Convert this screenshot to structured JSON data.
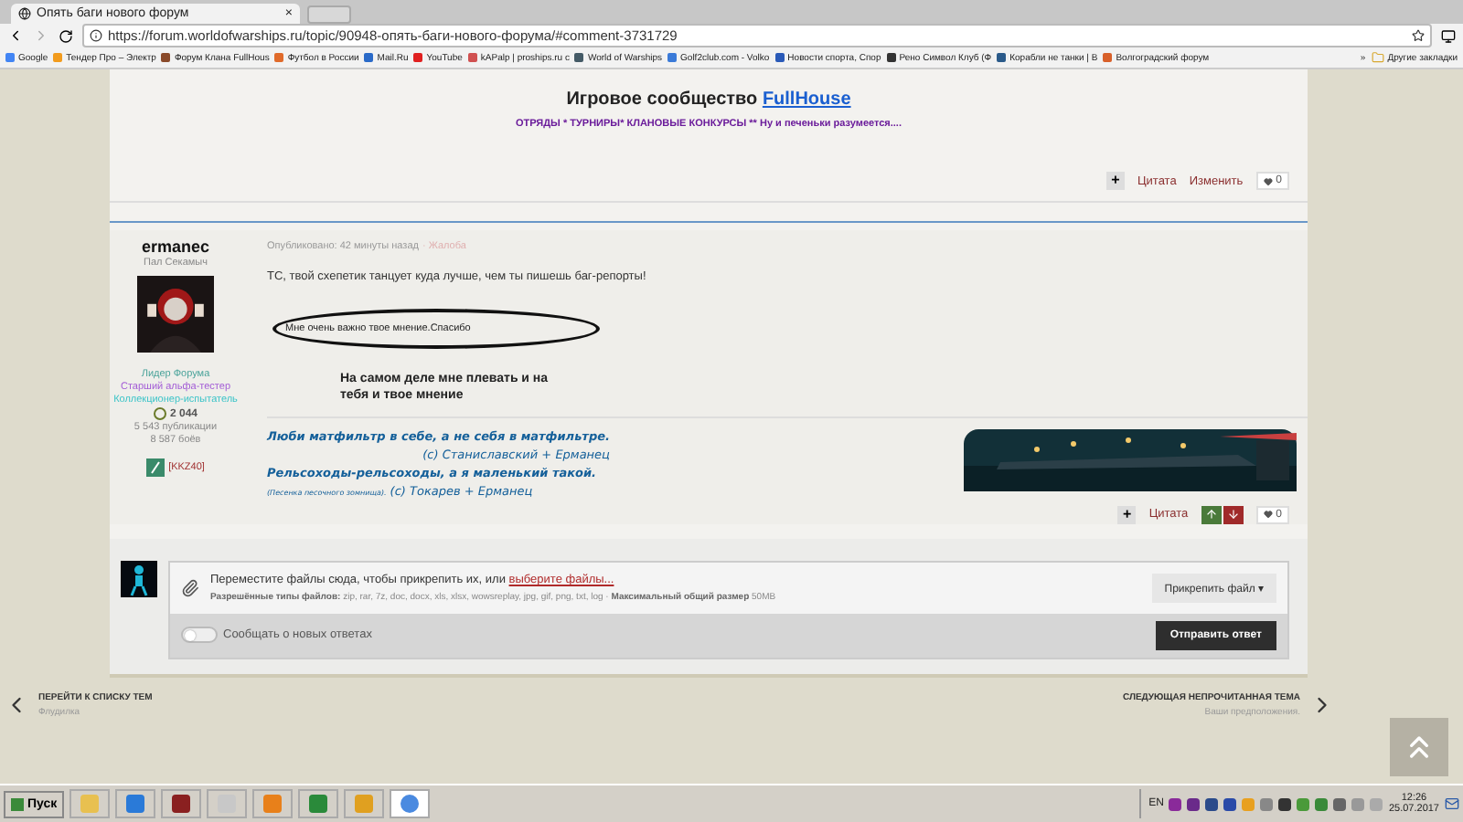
{
  "browser": {
    "tab_title": "Опять баги нового форум",
    "tab_close": "×",
    "url": "https://forum.worldofwarships.ru/topic/90948-опять-баги-нового-форума/#comment-3731729",
    "bookmarks": [
      "Google",
      "Тендер Про – Электр",
      "Форум Клана FullHous",
      "Футбол в России",
      "Mail.Ru",
      "YouTube",
      "kAPalp | proships.ru c",
      "World of Warships",
      "Golf2club.com - Volko",
      "Новости спорта, Спор",
      "Рено Символ Клуб (Ф",
      "Корабли не танки | В",
      "Волгоградский форум"
    ],
    "more": "»",
    "other_bookmarks": "Другие закладки"
  },
  "previous_post": {
    "heading": "Игровое сообщество ",
    "heading_link": "FullHouse",
    "tagline": "ОТРЯДЫ * ТУРНИРЫ* КЛАНОВЫЕ КОНКУРСЫ ** Ну и печеньки разумеется....",
    "actions": {
      "add": "+",
      "quote": "Цитата",
      "edit": "Изменить",
      "likes": "0"
    }
  },
  "post": {
    "author": "ermanec",
    "title": "Пал Секамыч",
    "ranks": [
      {
        "text": "Лидер Форума",
        "color": "#4aa39a"
      },
      {
        "text": "Старший альфа-тестер",
        "color": "#a35cd6"
      },
      {
        "text": "Коллекционер-испытатель",
        "color": "#3cc4c8"
      }
    ],
    "reputation": "2 044",
    "posts": "5 543 публикации",
    "battles": "8 587 боёв",
    "clan": "[KKZ40]",
    "published": "Опубликовано: 42 минуты назад",
    "report": "· Жалоба",
    "text": "ТС, твой схепетик танцует куда лучше, чем ты пишешь баг-репорты!",
    "bubble": "Мне очень важно твое мнение.Спасибо",
    "bold_text": "На самом деле мне плевать и на тебя и твое мнение",
    "signature": [
      "Люби матфильтр в себе, а не себя в матфильтре.",
      "(с) Станиславский + Ерманец",
      "Рельсоходы-рельсоходы, а я маленький такой."
    ],
    "signature_note": "(Песенка песочного зомнища).",
    "signature_credit": "(с) Токарев + Ерманец",
    "actions": {
      "add": "+",
      "quote": "Цитата",
      "likes": "0"
    }
  },
  "reply": {
    "drop_text": "Переместите файлы сюда, чтобы прикрепить их, или ",
    "choose_link": "выберите файлы...",
    "allowed": "**Разрешённые типы файлов:** zip, rar, 7z, doc, docx, xls, xlsx, wowsreplay, jpg, gif, png, txt, log · **Максимальный общий размер** 50MB",
    "attach_button": "Прикрепить файл ▾",
    "notify": {
      "label": "Сообщать о новых ответах",
      "on": false
    },
    "submit": "Отправить ответ"
  },
  "navigation": {
    "back_title": "ПЕРЕЙТИ К СПИСКУ ТЕМ",
    "back_sub": "Флудилка",
    "next_title": "СЛЕДУЮЩАЯ НЕПРОЧИТАННАЯ ТЕМА",
    "next_sub": "Ваши предположения."
  },
  "taskbar": {
    "start": "Пуск",
    "language": "EN",
    "time": "12:26",
    "date": "25.07.2017"
  }
}
